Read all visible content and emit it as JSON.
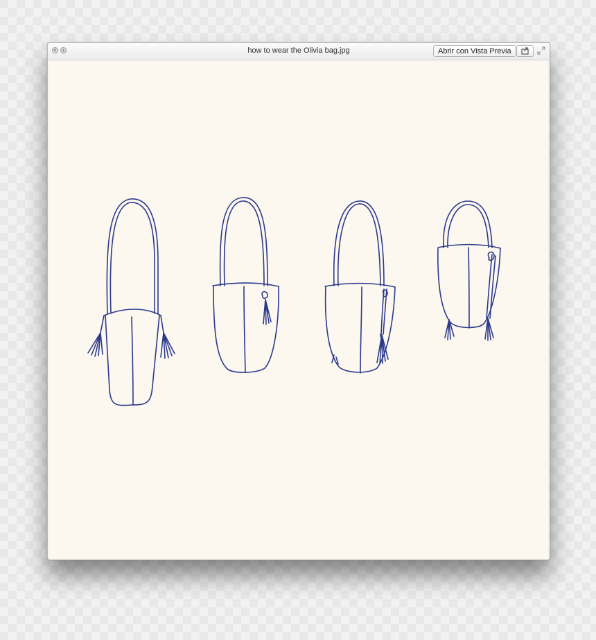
{
  "window": {
    "title": "how to wear the Olivia bag.jpg",
    "open_button": "Abrir con Vista Previa"
  },
  "icons": {
    "close": "close-icon",
    "zoom": "zoom-icon",
    "share": "share-icon",
    "fullscreen": "fullscreen-icon"
  },
  "colors": {
    "ink": "#2b3a8c",
    "paper": "#fcf7ef"
  },
  "image": {
    "subject": "four line drawings of the Olivia bag"
  }
}
